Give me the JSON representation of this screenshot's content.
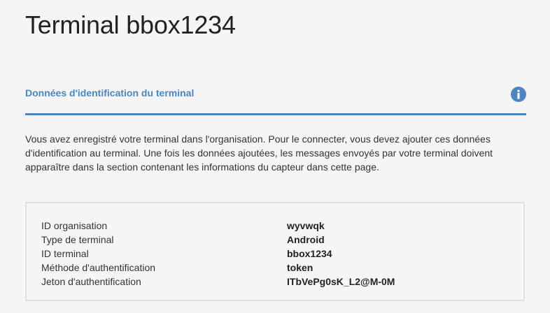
{
  "page": {
    "title": "Terminal bbox1234"
  },
  "section": {
    "title": "Données d'identification du terminal",
    "info_icon": "info-icon",
    "accent_color": "#4a86c5"
  },
  "description": "Vous avez enregistré votre terminal dans l'organisation. Pour le connecter, vous devez ajouter ces données d'identification au terminal. Une fois les données ajoutées, les messages envoyés par votre terminal doivent apparaître dans la section contenant les informations du capteur dans cette page.",
  "credentials": [
    {
      "label": "ID organisation",
      "value": "wyvwqk"
    },
    {
      "label": "Type de terminal",
      "value": "Android"
    },
    {
      "label": "ID terminal",
      "value": "bbox1234"
    },
    {
      "label": "Méthode d'authentification",
      "value": "token"
    },
    {
      "label": "Jeton d'authentification",
      "value": "ITbVePg0sK_L2@M-0M"
    }
  ]
}
